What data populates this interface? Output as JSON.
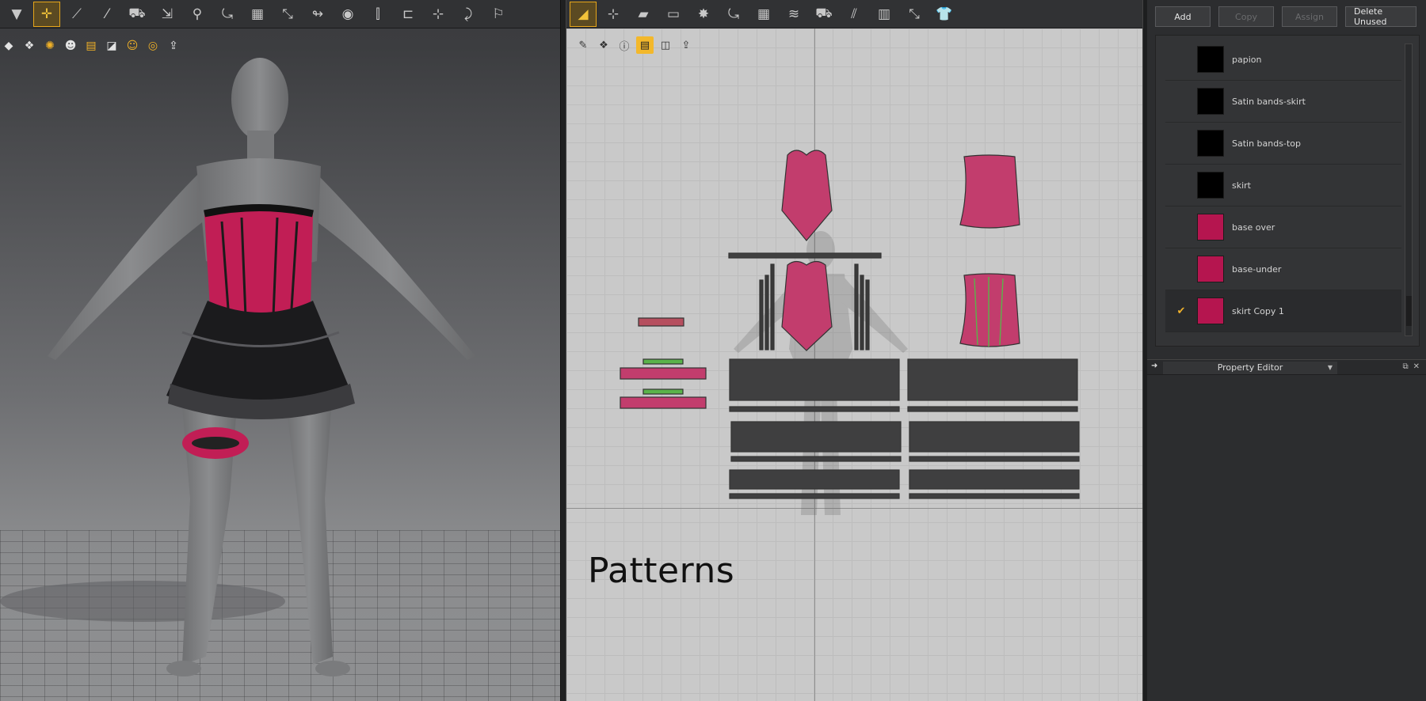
{
  "toolbar3d": {
    "tools": [
      {
        "name": "move-down-tool",
        "glyph": "▼"
      },
      {
        "name": "select-move-tool",
        "glyph": "✛",
        "active": true
      },
      {
        "name": "edit-pattern-tool",
        "glyph": "⟋"
      },
      {
        "name": "draw-line-tool",
        "glyph": "⁄"
      },
      {
        "name": "tack-tool",
        "glyph": "⛟"
      },
      {
        "name": "fold-tool",
        "glyph": "⇲"
      },
      {
        "name": "pin-tool",
        "glyph": "⚲"
      },
      {
        "name": "rotate-tool",
        "glyph": "⤿"
      },
      {
        "name": "mesh-tool",
        "glyph": "▦"
      },
      {
        "name": "measure-tool",
        "glyph": "⤡"
      },
      {
        "name": "arrange-tool",
        "glyph": "↬"
      },
      {
        "name": "button-tool",
        "glyph": "◉"
      },
      {
        "name": "zipper-tool",
        "glyph": "⫿"
      },
      {
        "name": "iron-tool",
        "glyph": "⊏"
      },
      {
        "name": "strengthen-tool",
        "glyph": "⊹"
      },
      {
        "name": "sculpt-tool",
        "glyph": "⤸"
      },
      {
        "name": "avatar-pose-tool",
        "glyph": "⚐"
      }
    ]
  },
  "subtools3d": [
    {
      "name": "cube-icon",
      "glyph": "◆",
      "orange": false
    },
    {
      "name": "garment-icon",
      "glyph": "❖",
      "orange": false
    },
    {
      "name": "texture-icon",
      "glyph": "✺",
      "orange": true
    },
    {
      "name": "avatar-icon",
      "glyph": "☻",
      "orange": false
    },
    {
      "name": "layer-icon",
      "glyph": "▤",
      "orange": true
    },
    {
      "name": "flat-icon",
      "glyph": "◪",
      "orange": false
    },
    {
      "name": "skin-icon",
      "glyph": "☺",
      "orange": true
    },
    {
      "name": "globe-icon",
      "glyph": "◎",
      "orange": true
    },
    {
      "name": "export-icon",
      "glyph": "⇪",
      "orange": false
    }
  ],
  "toolbar2d": {
    "tools": [
      {
        "name": "pattern-select-tool",
        "glyph": "◢",
        "active": true
      },
      {
        "name": "transform-tool",
        "glyph": "⊹"
      },
      {
        "name": "polygon-tool",
        "glyph": "▰"
      },
      {
        "name": "rectangle-tool",
        "glyph": "▭"
      },
      {
        "name": "dart-tool",
        "glyph": "✸"
      },
      {
        "name": "seam-tool",
        "glyph": "⤿"
      },
      {
        "name": "grid-tool",
        "glyph": "▦"
      },
      {
        "name": "internal-line-tool",
        "glyph": "≋"
      },
      {
        "name": "trace-tool",
        "glyph": "⛟"
      },
      {
        "name": "segment-sewing-tool",
        "glyph": "⫽"
      },
      {
        "name": "pleat-tool",
        "glyph": "▥"
      },
      {
        "name": "measure-tool",
        "glyph": "⤡"
      },
      {
        "name": "shirt-tool",
        "glyph": "👕"
      }
    ]
  },
  "canvas_tools": [
    {
      "name": "pen-icon",
      "glyph": "✎",
      "orange": false
    },
    {
      "name": "shirt-view-icon",
      "glyph": "❖",
      "orange": false
    },
    {
      "name": "info-icon",
      "glyph": "ⓘ",
      "orange": false
    },
    {
      "name": "texture-view-icon",
      "glyph": "▤",
      "orange": true
    },
    {
      "name": "garment-view-icon",
      "glyph": "◫",
      "orange": false
    },
    {
      "name": "export-view-icon",
      "glyph": "⇪",
      "orange": false
    }
  ],
  "canvas_label": "Patterns",
  "fabric_panel": {
    "buttons": [
      {
        "label": "Add",
        "enabled": true
      },
      {
        "label": "Copy",
        "enabled": false
      },
      {
        "label": "Assign",
        "enabled": false
      },
      {
        "label": "Delete Unused",
        "enabled": true
      }
    ],
    "items": [
      {
        "name": "papion",
        "color": "#000000",
        "checked": false
      },
      {
        "name": "Satin bands-skirt",
        "color": "#000000",
        "checked": false
      },
      {
        "name": "Satin bands-top",
        "color": "#000000",
        "checked": false
      },
      {
        "name": "skirt",
        "color": "#000000",
        "checked": false
      },
      {
        "name": "base over",
        "color": "#b5154f",
        "checked": false
      },
      {
        "name": "base-under",
        "color": "#b5154f",
        "checked": false
      },
      {
        "name": "skirt Copy 1",
        "color": "#b5154f",
        "checked": true
      }
    ]
  },
  "property_editor": {
    "title": "Property Editor"
  },
  "colors": {
    "accent": "#f1b22c",
    "fabric_pink": "#c23d6d",
    "fabric_dark": "#3f3f40"
  }
}
